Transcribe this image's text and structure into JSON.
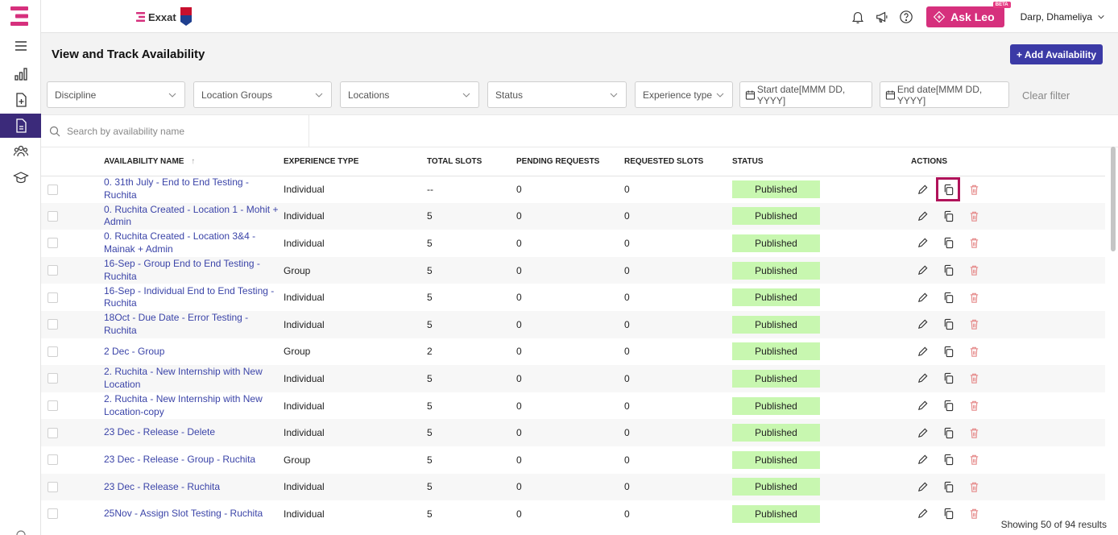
{
  "topbar": {
    "brand": "Exxat",
    "ask_leo": "Ask Leo",
    "beta": "BETA",
    "user": "Darp, Dhameliya"
  },
  "page": {
    "title": "View and Track Availability",
    "add_button": "+ Add Availability"
  },
  "filters": {
    "discipline": "Discipline",
    "location_groups": "Location Groups",
    "locations": "Locations",
    "status": "Status",
    "experience_type": "Experience type",
    "start_date": "Start date[MMM DD, YYYY]",
    "end_date": "End date[MMM DD, YYYY]",
    "clear": "Clear filter"
  },
  "search": {
    "placeholder": "Search by availability name"
  },
  "table": {
    "headers": {
      "name": "AVAILABILITY NAME",
      "experience": "EXPERIENCE TYPE",
      "total": "TOTAL SLOTS",
      "pending": "PENDING REQUESTS",
      "requested": "REQUESTED SLOTS",
      "status": "STATUS",
      "actions": "ACTIONS"
    },
    "rows": [
      {
        "name": "0. 31th July - End to End Testing - Ruchita",
        "experience": "Individual",
        "total": "--",
        "pending": "0",
        "requested": "0",
        "status": "Published"
      },
      {
        "name": "0. Ruchita Created - Location 1 - Mohit + Admin",
        "experience": "Individual",
        "total": "5",
        "pending": "0",
        "requested": "0",
        "status": "Published"
      },
      {
        "name": "0. Ruchita Created - Location 3&4 - Mainak + Admin",
        "experience": "Individual",
        "total": "5",
        "pending": "0",
        "requested": "0",
        "status": "Published"
      },
      {
        "name": "16-Sep - Group End to End Testing - Ruchita",
        "experience": "Group",
        "total": "5",
        "pending": "0",
        "requested": "0",
        "status": "Published"
      },
      {
        "name": "16-Sep - Individual End to End Testing - Ruchita",
        "experience": "Individual",
        "total": "5",
        "pending": "0",
        "requested": "0",
        "status": "Published"
      },
      {
        "name": "18Oct - Due Date - Error Testing - Ruchita",
        "experience": "Individual",
        "total": "5",
        "pending": "0",
        "requested": "0",
        "status": "Published"
      },
      {
        "name": "2 Dec - Group",
        "experience": "Group",
        "total": "2",
        "pending": "0",
        "requested": "0",
        "status": "Published"
      },
      {
        "name": "2. Ruchita - New Internship with New Location",
        "experience": "Individual",
        "total": "5",
        "pending": "0",
        "requested": "0",
        "status": "Published"
      },
      {
        "name": "2. Ruchita - New Internship with New Location-copy",
        "experience": "Individual",
        "total": "5",
        "pending": "0",
        "requested": "0",
        "status": "Published"
      },
      {
        "name": "23 Dec - Release - Delete",
        "experience": "Individual",
        "total": "5",
        "pending": "0",
        "requested": "0",
        "status": "Published"
      },
      {
        "name": "23 Dec - Release - Group - Ruchita",
        "experience": "Group",
        "total": "5",
        "pending": "0",
        "requested": "0",
        "status": "Published"
      },
      {
        "name": "23 Dec - Release - Ruchita",
        "experience": "Individual",
        "total": "5",
        "pending": "0",
        "requested": "0",
        "status": "Published"
      },
      {
        "name": "25Nov - Assign Slot Testing - Ruchita",
        "experience": "Individual",
        "total": "5",
        "pending": "0",
        "requested": "0",
        "status": "Published"
      }
    ]
  },
  "footer": {
    "results": "Showing 50 of 94 results"
  },
  "colors": {
    "accent": "#3b3aa6",
    "brand": "#d6307d",
    "status_bg": "#c8f7b0",
    "link": "#3b44a8",
    "delete": "#e58a8a",
    "highlight": "#b0135a"
  },
  "icons": [
    "menu-icon",
    "chart-icon",
    "add-doc-icon",
    "doc-icon",
    "people-icon",
    "graduation-icon",
    "bell-icon",
    "megaphone-icon",
    "help-icon",
    "edit-icon",
    "copy-icon",
    "delete-icon",
    "calendar-icon",
    "search-icon",
    "chevron-down-icon"
  ]
}
